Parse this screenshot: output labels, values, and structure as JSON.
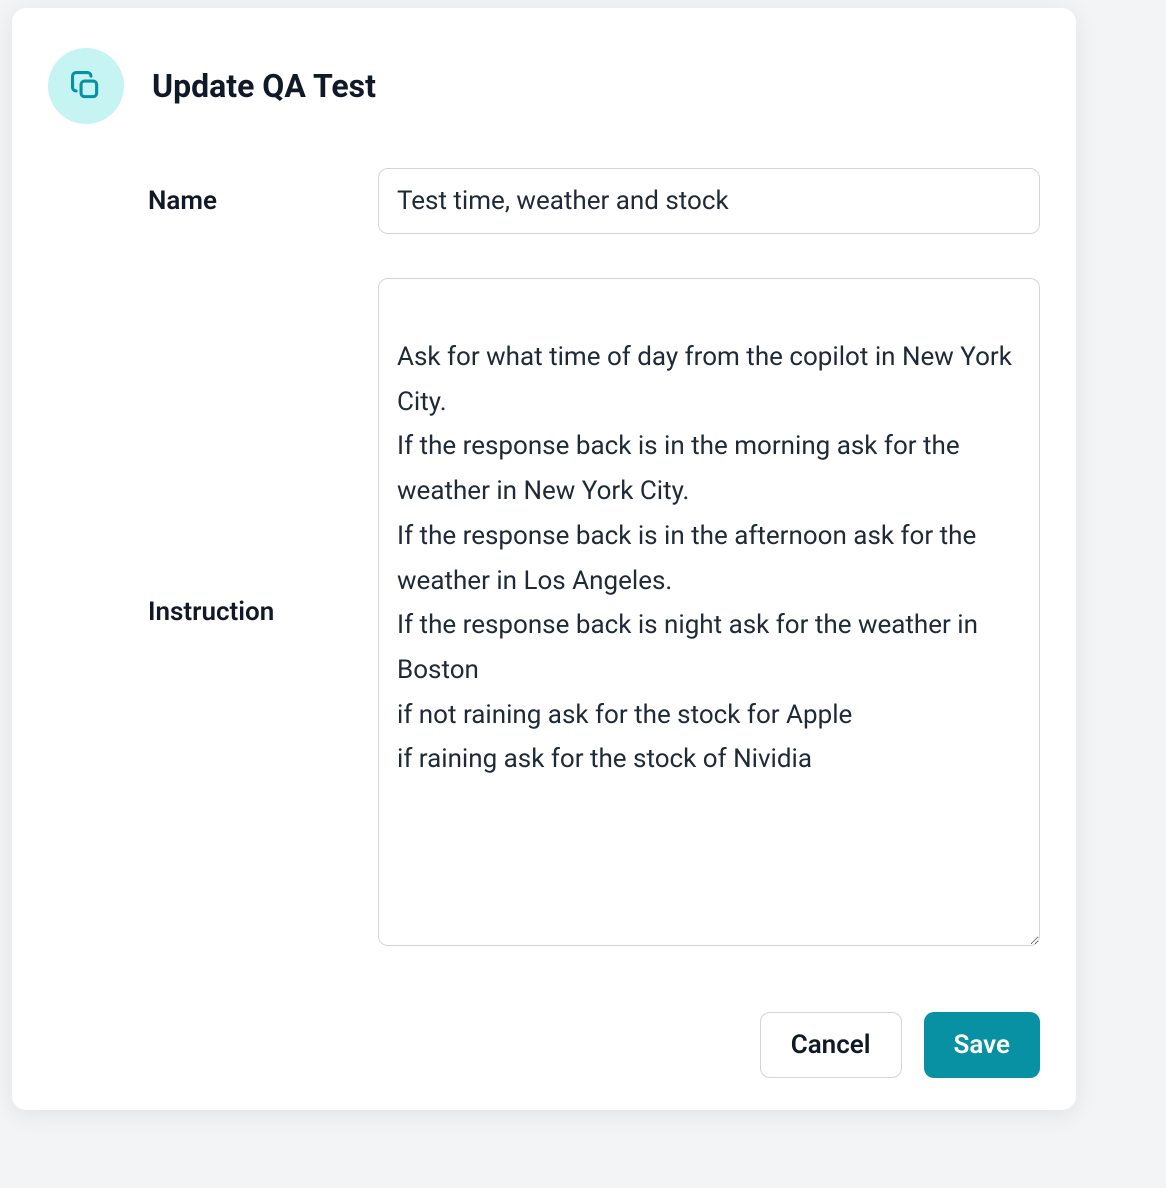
{
  "modal": {
    "title": "Update QA Test",
    "icon": "copy-icon",
    "fields": {
      "name": {
        "label": "Name",
        "value": "Test time, weather and stock"
      },
      "instruction": {
        "label": "Instruction",
        "value": "Ask for what time of day from the copilot in New York City.\nIf the response back is in the morning ask for the weather in New York City.\nIf the response back is in the afternoon ask for the weather in Los Angeles.\nIf the response back is night ask for the weather in Boston\nif not raining ask for the stock for Apple\nif raining ask for the stock of Nividia"
      }
    },
    "buttons": {
      "cancel": "Cancel",
      "save": "Save"
    }
  },
  "colors": {
    "accent": "#0891a3",
    "iconBg": "#c6f4f2",
    "border": "#d1d5db",
    "text": "#111827"
  }
}
